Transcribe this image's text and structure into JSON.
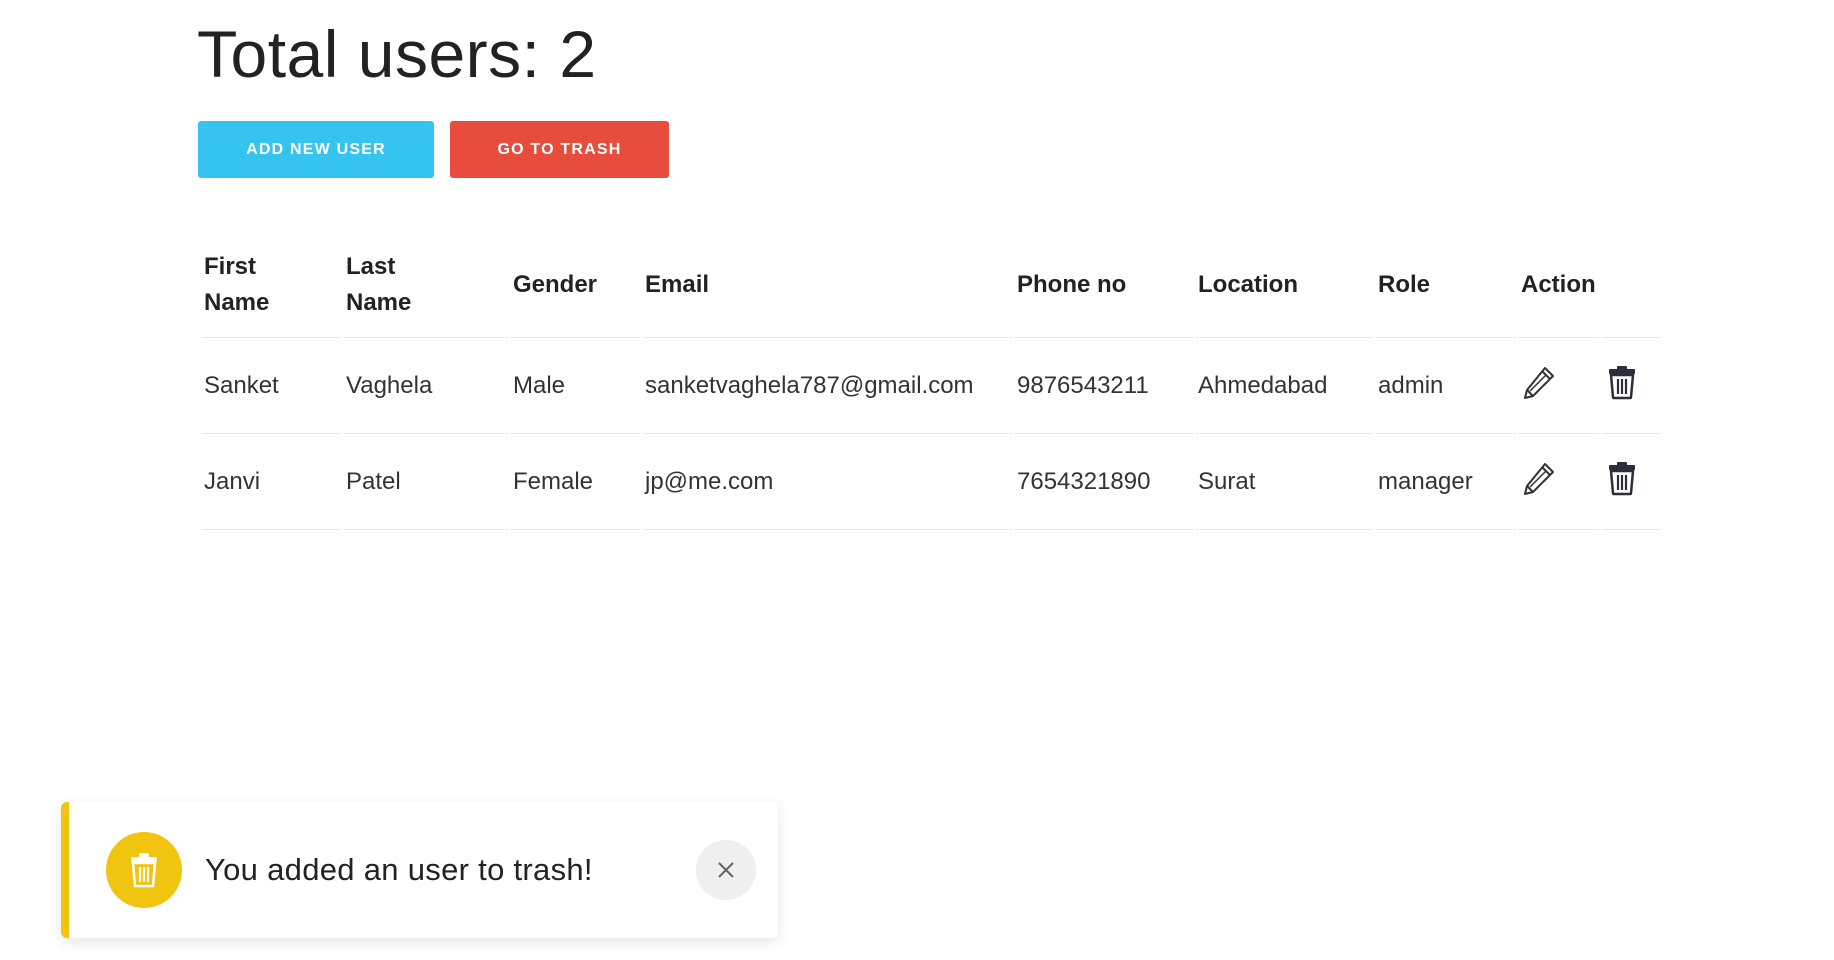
{
  "header": {
    "title": "Total users: 2"
  },
  "toolbar": {
    "add_label": "ADD NEW USER",
    "trash_label": "GO TO TRASH"
  },
  "table": {
    "columns": [
      "First Name",
      "Last Name",
      "Gender",
      "Email",
      "Phone no",
      "Location",
      "Role",
      "Action"
    ],
    "rows": [
      {
        "first_name": "Sanket",
        "last_name": "Vaghela",
        "gender": "Male",
        "email": "sanketvaghela787@gmail.com",
        "phone": "9876543211",
        "location": "Ahmedabad",
        "role": "admin",
        "actions": [
          "pencil-icon",
          "trash-icon"
        ]
      },
      {
        "first_name": "Janvi",
        "last_name": "Patel",
        "gender": "Female",
        "email": "jp@me.com",
        "phone": "7654321890",
        "location": "Surat",
        "role": "manager",
        "actions": [
          "pencil-icon",
          "trash-icon"
        ]
      }
    ]
  },
  "toast": {
    "message": "You added an user to trash!",
    "icon": "trash-icon",
    "close_icon": "close-icon"
  },
  "colors": {
    "add_button": "#35c3ef",
    "trash_button": "#e74c3c",
    "toast_accent": "#f1c40f"
  }
}
